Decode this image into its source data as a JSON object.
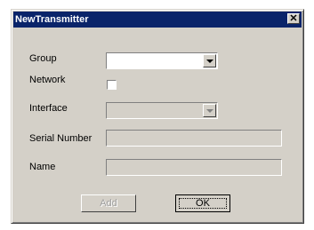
{
  "window": {
    "title": "NewTransmitter",
    "close_glyph": "✕"
  },
  "fields": {
    "group_label": "Group",
    "group_value": "",
    "network_label": "Network",
    "network_checked": false,
    "interface_label": "Interface",
    "interface_value": "",
    "serial_label": "Serial Number",
    "serial_value": "",
    "name_label": "Name",
    "name_value": ""
  },
  "buttons": {
    "add_label": "Add",
    "ok_label": "OK"
  },
  "colors": {
    "titlebar": "#0a246a",
    "face": "#d4d0c8"
  }
}
